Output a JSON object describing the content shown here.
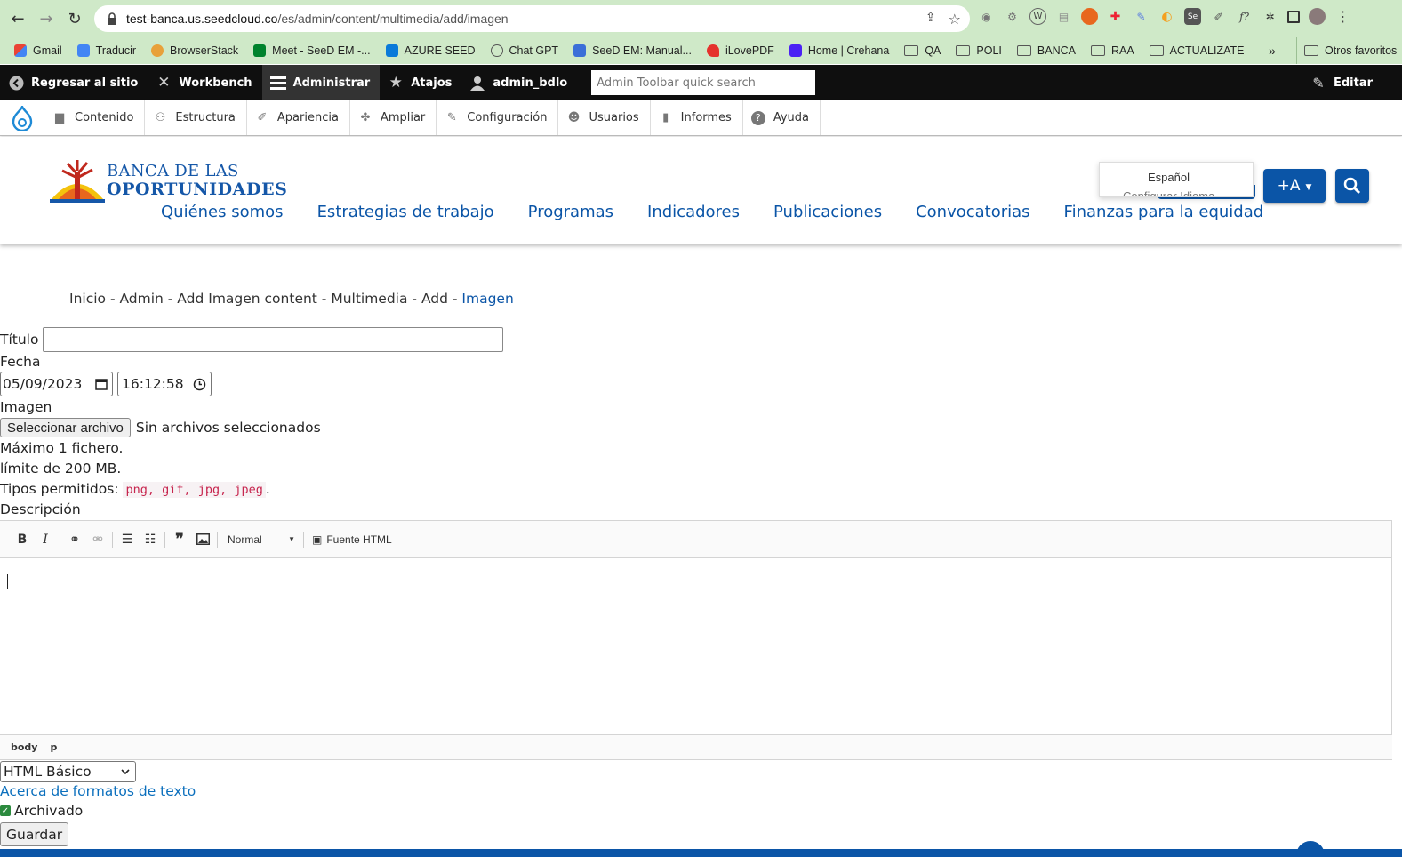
{
  "browser": {
    "url_host": "test-banca.us.seedcloud.co",
    "url_path": "/es/admin/content/multimedia/add/imagen",
    "bookmarks": [
      "Gmail",
      "Traducir",
      "BrowserStack",
      "Meet - SeeD EM -...",
      "AZURE SEED",
      "Chat GPT",
      "SeeD EM: Manual...",
      "iLovePDF",
      "Home | Crehana",
      "QA",
      "POLI",
      "BANCA",
      "RAA",
      "ACTUALIZATE"
    ],
    "more_bookmarks": "»",
    "other_bookmarks": "Otros favoritos"
  },
  "admin_toolbar": {
    "back": "Regresar al sitio",
    "workbench": "Workbench",
    "manage": "Administrar",
    "shortcuts": "Atajos",
    "user": "admin_bdlo",
    "search_placeholder": "Admin Toolbar quick search",
    "edit": "Editar"
  },
  "admin_tray": {
    "items": [
      "Contenido",
      "Estructura",
      "Apariencia",
      "Ampliar",
      "Configuración",
      "Usuarios",
      "Informes",
      "Ayuda"
    ]
  },
  "site": {
    "logo_line1": "BANCA DE LAS",
    "logo_line2": "OPORTUNIDADES",
    "menu": [
      "Quiénes somos",
      "Estrategias de trabajo",
      "Programas",
      "Indicadores",
      "Publicaciones",
      "Convocatorias",
      "Finanzas para la equidad"
    ],
    "language_option": "Español",
    "language_cut": "Configurar Idioma",
    "font_button": "+A"
  },
  "breadcrumb": {
    "trail": "Inicio - Admin - Add Imagen content - Multimedia - Add - ",
    "current": "Imagen"
  },
  "form": {
    "title_label": "Título",
    "title_value": "",
    "date_label": "Fecha",
    "date_value": "05/09/2023",
    "time_value": "16:12:58",
    "image_label": "Imagen",
    "file_button": "Seleccionar archivo",
    "file_status": "Sin archivos seleccionados",
    "help_max": "Máximo 1 fichero.",
    "help_limit": "límite de 200 MB.",
    "help_types_label": "Tipos permitidos: ",
    "help_types": "png, gif, jpg, jpeg",
    "help_types_end": ".",
    "description_label": "Descripción",
    "editor_format": "Normal",
    "editor_source": "Fuente HTML",
    "editor_path": [
      "body",
      "p"
    ],
    "text_format": "HTML Básico",
    "about_formats": "Acerca de formatos de texto",
    "archived_label": "Archivado",
    "archived_checked": true,
    "save_button": "Guardar"
  },
  "colors": {
    "chrome": "#cfe9c8",
    "admin_bar": "#0f0f0f",
    "brand_blue": "#0b55a7"
  }
}
